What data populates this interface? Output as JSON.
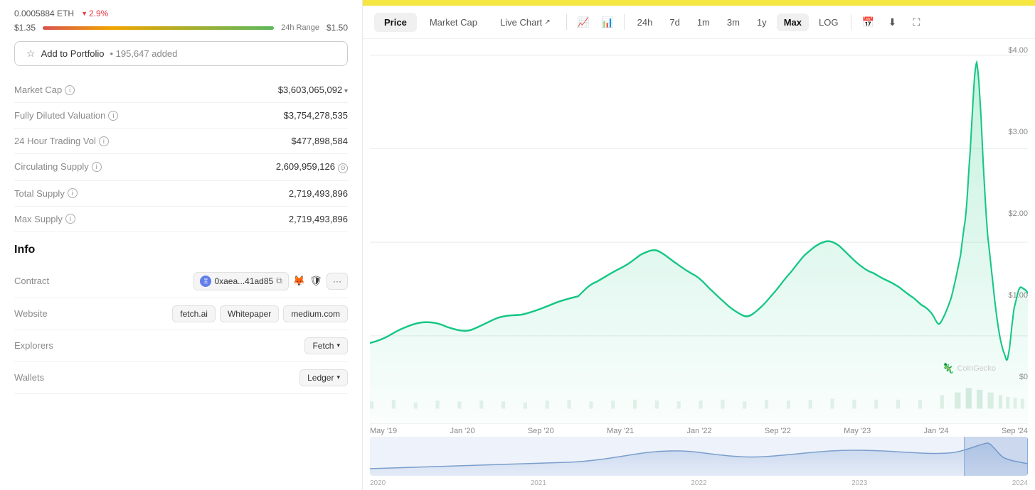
{
  "left": {
    "eth_price": "0.0005884 ETH",
    "price_change": "2.9%",
    "range_low": "$1.35",
    "range_label": "24h Range",
    "range_high": "$1.50",
    "add_portfolio_label": "Add to Portfolio",
    "portfolio_count": "195,647 added",
    "stats": [
      {
        "label": "Market Cap",
        "value": "$3,603,065,092",
        "has_info": true,
        "has_expand": true
      },
      {
        "label": "Fully Diluted Valuation",
        "value": "$3,754,278,535",
        "has_info": true
      },
      {
        "label": "24 Hour Trading Vol",
        "value": "$477,898,584",
        "has_info": true
      },
      {
        "label": "Circulating Supply",
        "value": "2,609,959,126",
        "has_info": true,
        "has_supply_icon": true
      },
      {
        "label": "Total Supply",
        "value": "2,719,493,896",
        "has_info": true
      },
      {
        "label": "Max Supply",
        "value": "2,719,493,896",
        "has_info": true
      }
    ],
    "info_section": "Info",
    "contract_label": "Contract",
    "contract_address": "0xaea...41ad85",
    "website_label": "Website",
    "website_links": [
      "fetch.ai",
      "Whitepaper",
      "medium.com"
    ],
    "explorers_label": "Explorers",
    "explorer_value": "Fetch",
    "wallets_label": "Wallets",
    "wallet_value": "Ledger"
  },
  "right": {
    "banner_color": "#f5e642",
    "tabs": [
      {
        "label": "Price",
        "active": true
      },
      {
        "label": "Market Cap",
        "active": false
      },
      {
        "label": "Live Chart",
        "active": false,
        "external": true
      }
    ],
    "time_ranges": [
      "24h",
      "7d",
      "1m",
      "3m",
      "1y",
      "Max"
    ],
    "active_time": "Max",
    "log_label": "LOG",
    "x_labels": [
      "May '19",
      "Jan '20",
      "Sep '20",
      "May '21",
      "Jan '22",
      "Sep '22",
      "May '23",
      "Jan '24",
      "Sep '24"
    ],
    "y_labels": [
      "$4.00",
      "$3.00",
      "$2.00",
      "$1.00",
      "$0"
    ],
    "mini_x_labels": [
      "2020",
      "2021",
      "2022",
      "2023",
      "2024"
    ],
    "coingecko": "CoinGecko"
  }
}
